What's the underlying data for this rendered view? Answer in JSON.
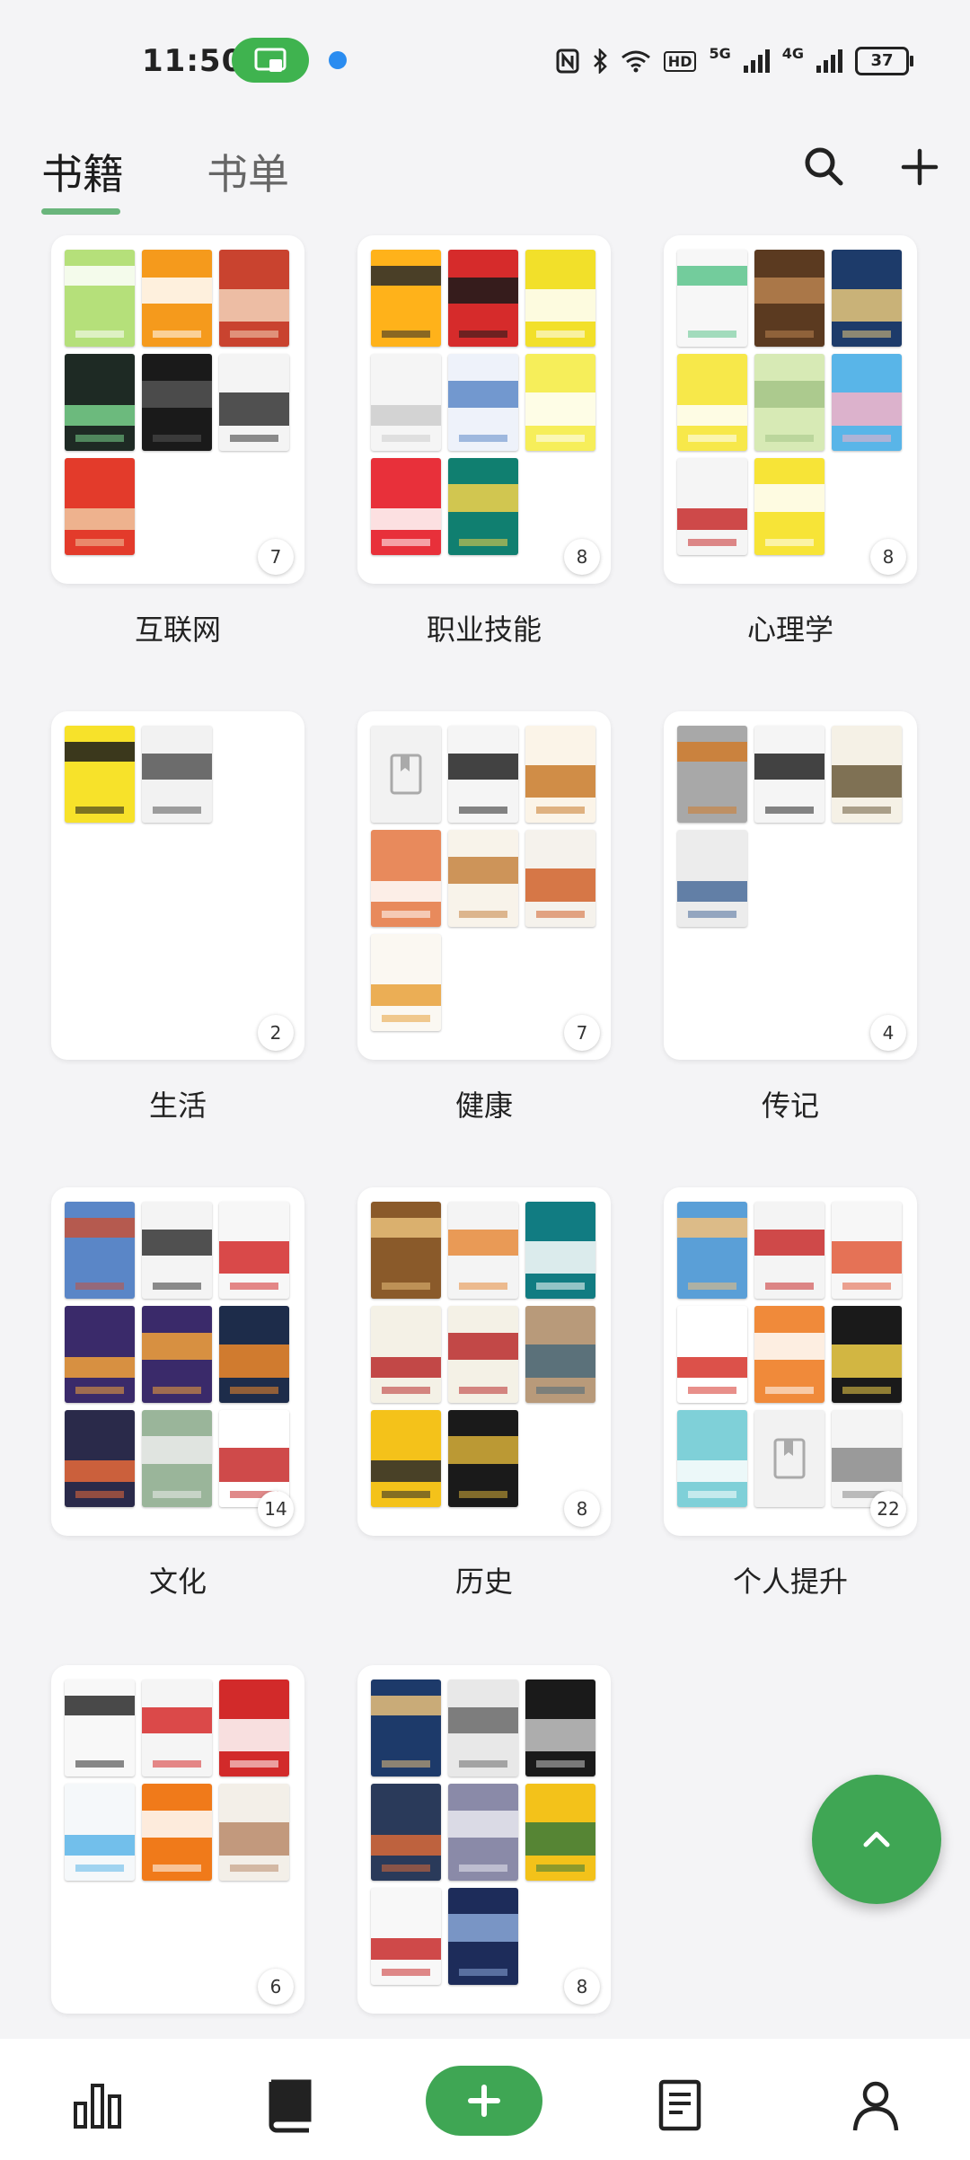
{
  "status_bar": {
    "time": "11:50",
    "network": "5G",
    "network2": "4G",
    "hd": "HD",
    "battery": "37",
    "icons": [
      "screen-cast-icon",
      "app-dot-icon",
      "nfc-icon",
      "bluetooth-icon",
      "wifi-icon",
      "signal-icon",
      "battery-icon"
    ]
  },
  "header": {
    "tab_books": "书籍",
    "tab_booklists": "书单",
    "active_tab": "书籍",
    "accent_color": "#3fa654",
    "icons": [
      "search-icon",
      "plus-icon"
    ]
  },
  "shelves": [
    {
      "name": "互联网",
      "count": "7",
      "covers": [
        [
          "#b5e07a",
          "#ffffff"
        ],
        [
          "#f59a1c",
          "#ffffff"
        ],
        [
          "#c9432f",
          "#f3d2b8"
        ],
        [
          "#1e2a24",
          "#7ad48d"
        ],
        [
          "#1a1a1a",
          "#555555"
        ],
        [
          "#f4f4f4",
          "#333333"
        ],
        [
          "#e33b2b",
          "#f0c8a0"
        ]
      ]
    },
    {
      "name": "职业技能",
      "count": "8",
      "covers": [
        [
          "#ffb21a",
          "#2a2a2a"
        ],
        [
          "#d62b2b",
          "#1a1a1a"
        ],
        [
          "#f2e02a",
          "#ffffff"
        ],
        [
          "#f5f5f5",
          "#cccccc"
        ],
        [
          "#eef2fa",
          "#5c88c7"
        ],
        [
          "#f6ee5a",
          "#ffffff"
        ],
        [
          "#e8303a",
          "#ffffff"
        ],
        [
          "#107f70",
          "#f3d24a"
        ]
      ]
    },
    {
      "name": "心理学",
      "count": "8",
      "covers": [
        [
          "#f7f7f7",
          "#5cc48c"
        ],
        [
          "#5b3a20",
          "#b98350"
        ],
        [
          "#1d3b6a",
          "#e8c87a"
        ],
        [
          "#f7e84a",
          "#ffffff"
        ],
        [
          "#d7eab5",
          "#a4c487"
        ],
        [
          "#59b5e8",
          "#f3b1c7"
        ],
        [
          "#f5f5f5",
          "#c72a2a"
        ],
        [
          "#f7e437",
          "#ffffff"
        ]
      ]
    },
    {
      "name": "生活",
      "count": "2",
      "covers": [
        [
          "#f7e22a",
          "#1a1a1a"
        ],
        [
          "#f2f2f2",
          "#555555"
        ]
      ]
    },
    {
      "name": "健康",
      "count": "7",
      "covers": [
        [
          "placeholder",
          ""
        ],
        [
          "#f5f5f5",
          "#222222"
        ],
        [
          "#fbf4e8",
          "#c87a2a"
        ],
        [
          "#e88a5c",
          "#ffffff"
        ],
        [
          "#f8f3ea",
          "#c58240"
        ],
        [
          "#f5f2ec",
          "#d0612a"
        ],
        [
          "#fbf8f2",
          "#e8a13a"
        ]
      ]
    },
    {
      "name": "传记",
      "count": "4",
      "covers": [
        [
          "#a8a8a8",
          "#d07b2c"
        ],
        [
          "#f5f5f5",
          "#222222"
        ],
        [
          "#f5f1e6",
          "#6a5a3a"
        ],
        [
          "#ececec",
          "#4a6c9a"
        ]
      ]
    },
    {
      "name": "文化",
      "count": "14",
      "covers": [
        [
          "#5a86c7",
          "#c6523a"
        ],
        [
          "#f4f4f4",
          "#333333"
        ],
        [
          "#f7f7f7",
          "#d32a2a"
        ],
        [
          "#3a2a6a",
          "#f3a23a"
        ],
        [
          "#3a2a6a",
          "#f3a23a"
        ],
        [
          "#1d2c4a",
          "#f08a2a"
        ],
        [
          "#2a2a4a",
          "#e86a3a"
        ],
        [
          "#9ab59a",
          "#ececec"
        ],
        [
          "#ffffff",
          "#c72a2a"
        ]
      ]
    },
    {
      "name": "历史",
      "count": "8",
      "covers": [
        [
          "#8a5a2a",
          "#e8c07a"
        ],
        [
          "#f4f4f4",
          "#e68a3a"
        ],
        [
          "#117c82",
          "#ffffff"
        ],
        [
          "#f4f1e6",
          "#b82a2a"
        ],
        [
          "#f4f1e6",
          "#b82a2a"
        ],
        [
          "#b89a7a",
          "#4a6a7a"
        ],
        [
          "#f4c21a",
          "#2a2a2a"
        ],
        [
          "#1a1a1a",
          "#d8b03a"
        ]
      ]
    },
    {
      "name": "个人提升",
      "count": "22",
      "covers": [
        [
          "#5a9fd7",
          "#f3c07a"
        ],
        [
          "#f4f4f4",
          "#c82a2a"
        ],
        [
          "#f7f7f7",
          "#e25a3a"
        ],
        [
          "#ffffff",
          "#d6332a"
        ],
        [
          "#f08a3a",
          "#ffffff"
        ],
        [
          "#1a1a1a",
          "#f3d24a"
        ],
        [
          "#7fd0d8",
          "#ffffff"
        ],
        [
          "placeholder",
          ""
        ],
        [
          "#f4f4f4",
          "#8a8a8a"
        ]
      ]
    },
    {
      "name": "",
      "count": "6",
      "covers": [
        [
          "#f8f8f8",
          "#2a2a2a"
        ],
        [
          "#f5f5f5",
          "#d62a2a"
        ],
        [
          "#d22a2a",
          "#ffffff"
        ],
        [
          "#f5f8fa",
          "#5ab5e8"
        ],
        [
          "#f07a1a",
          "#ffffff"
        ],
        [
          "#f3efe8",
          "#b88a6a"
        ]
      ]
    },
    {
      "name": "",
      "count": "8",
      "covers": [
        [
          "#1d3a6a",
          "#e8c07a"
        ],
        [
          "#e8e8e8",
          "#6a6a6a"
        ],
        [
          "#1a1a1a",
          "#c8c8c8"
        ],
        [
          "#2a3a5a",
          "#d86a3a"
        ],
        [
          "#8a8aa8",
          "#e8e8f0"
        ],
        [
          "#f3c21a",
          "#3a7a3a"
        ],
        [
          "#f8f8f8",
          "#c82a2a"
        ],
        [
          "#1d2c5a",
          "#8aa8d8"
        ]
      ]
    }
  ],
  "fab": {
    "icon": "chevron-up-icon"
  },
  "bottom_nav": {
    "items": [
      "stats-icon",
      "book-icon",
      "add-icon",
      "notes-icon",
      "profile-icon"
    ],
    "active": "book-icon"
  }
}
